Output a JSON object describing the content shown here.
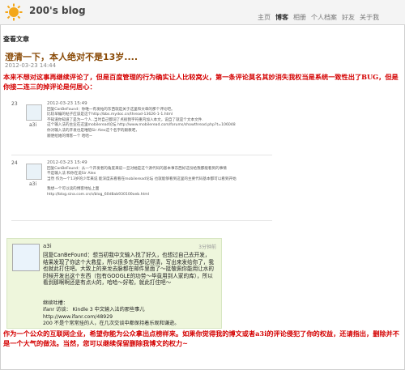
{
  "header": {
    "blog_title": "200's blog",
    "nav": [
      "主页",
      "博客",
      "相册",
      "个人档案",
      "好友",
      "关于我"
    ],
    "active_nav": "博客"
  },
  "page": {
    "section_label": "查看文章",
    "post_title": "澄清一下，本人绝对不是13岁....",
    "post_date": "2012-03-23 14:44",
    "intro": "本来不想对这事再继续评论了，但是百度管理的行为确实让人比较窝火，第一条评论莫名其妙消失我权当是系统一致性出了BUG，但是你接二连三的掉评论是何居心："
  },
  "comments": [
    {
      "num": "23",
      "user": "a3i",
      "time": "2012-03-23 15:49",
      "lines": [
        "回复CanBeFound：你唯一有发帖的东西就是关于这里和文章的那个评论吧。",
        "比较早编的帖子应该是这个http://bbs.mydoc.cn/thread-13626-1-1.html",
        "不知道你知道了是为一个人..当时自己都词了点很我字符重内加入本文，说自了就是个文本文件.",
        "这个输入法的主业在这里mobileread论坛 http://www.mobileread.com/forums/showthread.php?t=106048",
        "你对输入法的开发也是唯陪Sir Alex这个名字的跟教吧，",
        "顺便给她的博客一个 哈哈~"
      ]
    },
    {
      "num": "24",
      "user": "a3i",
      "time": "2012-03-23 15:49",
      "lines": [
        "回复CanBeFound：从一个开发者的角度来说一旦对她是这个源代码的基本事东西好这份给我都能看到的事情",
        "不是输入法 和你在说Sir Alex",
        "当然 作为一个13岁的少年来说 能深度去看看在mobileread论坛 也就能够看到这里的主要代码基本都可以看到开始",
        "",
        "我想一个可以读的博客地址上面",
        "http://blog.sina.com.cn/s/blog_60d8ab930100oeb.html"
      ]
    }
  ],
  "reply": {
    "user": "a3i",
    "meta": "3分钟前",
    "body": "回复CanBeFound：想当初我中文输入找了好久，也想过自己去开发，结果发现了你这个大救星，所以很多东西都记得清，写出来发给你了，我也就此打住吧。大致上的来龙去脉都在邮件里面了～挺敬佩你能用让水的时候开发出这个东西（包有GOOGLE的功劳～毕竟用到人家的库），所以看到那啊啊还是有点火的，哈哈～好啦，就此打住吧～",
    "foot_title": "继续吐槽：",
    "foot_lines": [
      "ifanr 访谈： Kindle 3 中文输入法的那些事儿",
      "http://www.ifanr.com/48929",
      "200 不是个常常挂的人，在几次交谈中都保持着乐观和谦逊。"
    ]
  },
  "outro": "作为一个公众的互联网企业，希望你能为公众拿出点榜样来。如果你觉得我的博文或者a3i的评论侵犯了你的权益，还请指出，删除并不是一个大气的做法。当然，您可以继续保留删除我博文的权力~"
}
